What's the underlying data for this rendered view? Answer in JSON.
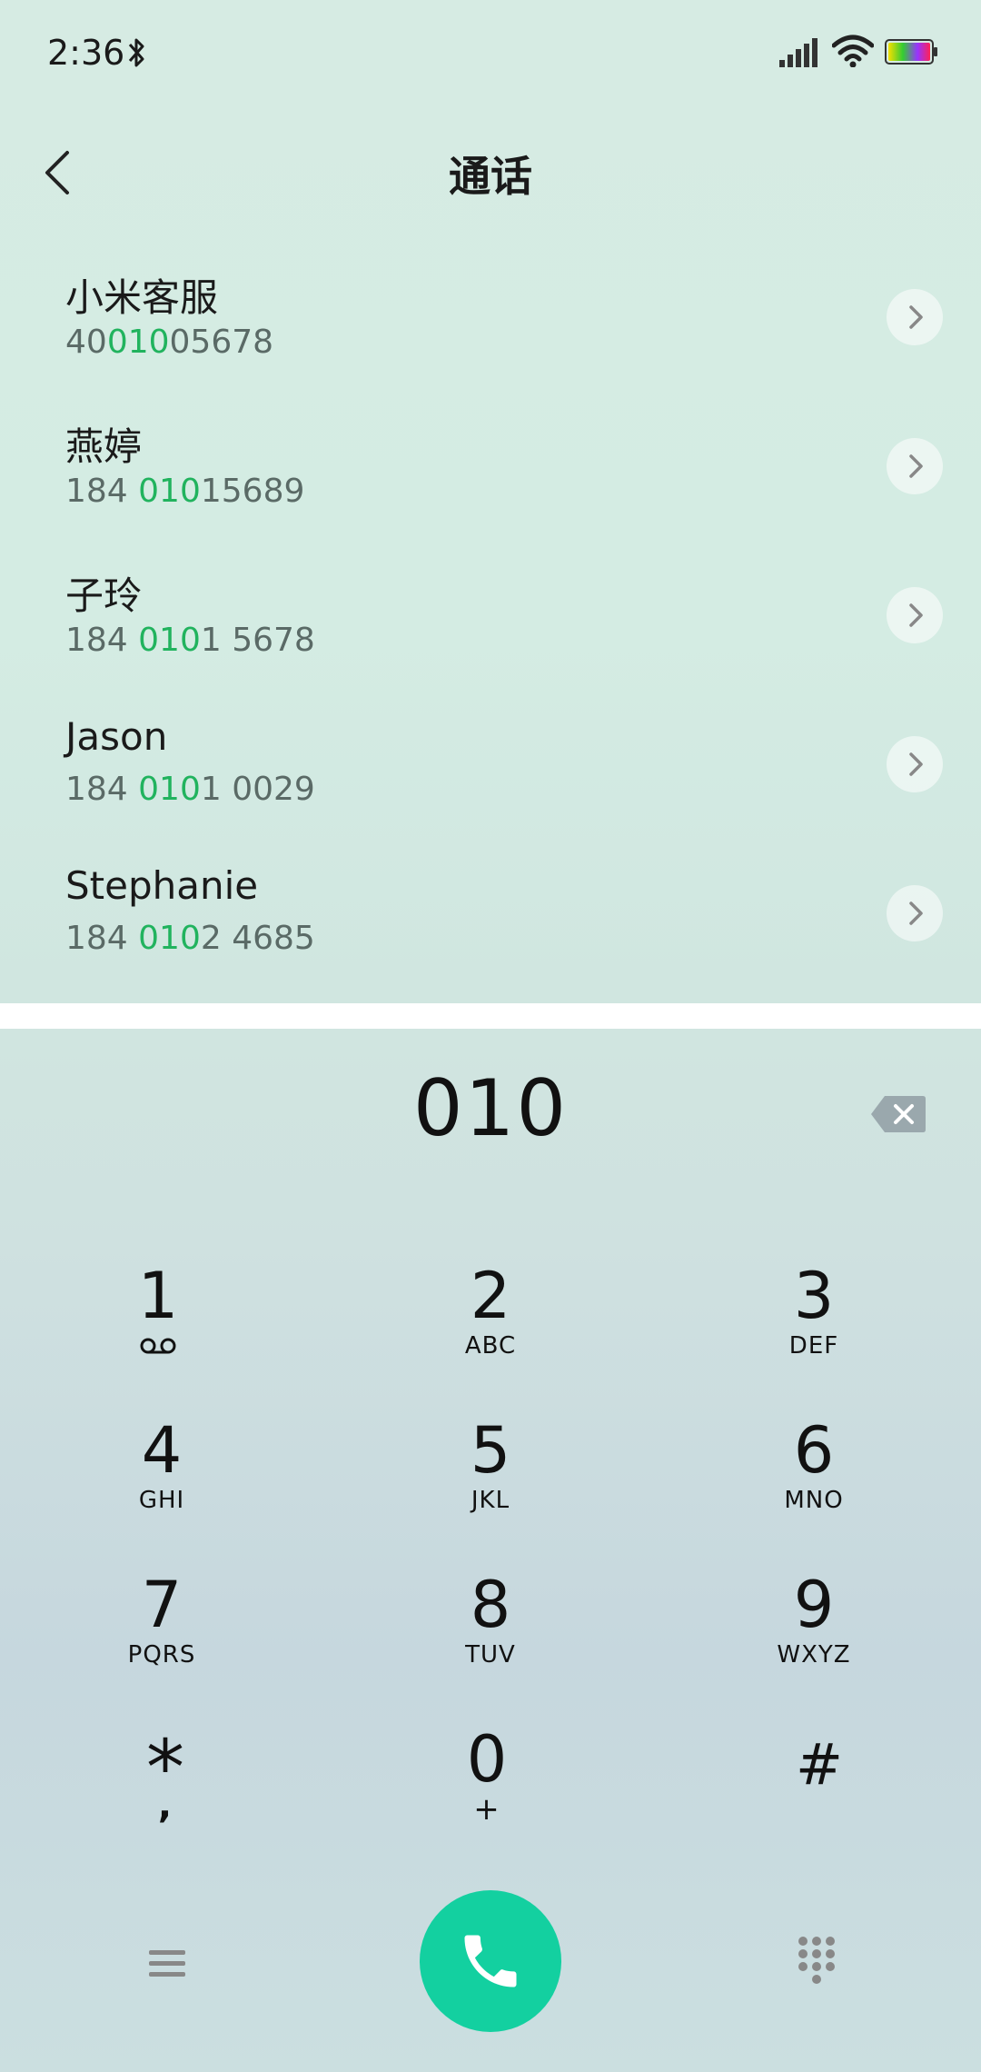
{
  "status_bar": {
    "time": "2:36",
    "icons": [
      "bluetooth-icon",
      "signal-icon",
      "wifi-icon",
      "battery-icon"
    ]
  },
  "header": {
    "title": "通话",
    "back_icon": "chevron-left-icon"
  },
  "contacts": [
    {
      "name": "小米客服",
      "number_pre": "40",
      "number_match": "010",
      "number_post": "05678"
    },
    {
      "name": "燕婷",
      "number_pre": "184 ",
      "number_match": "010",
      "number_post": "15689"
    },
    {
      "name": "子玲",
      "number_pre": "184 ",
      "number_match": "010",
      "number_post": "1 5678"
    },
    {
      "name": "Jason",
      "number_pre": "184 ",
      "number_match": "010",
      "number_post": "1 0029"
    },
    {
      "name": "Stephanie",
      "number_pre": "184 ",
      "number_match": "010",
      "number_post": "2 4685"
    }
  ],
  "dialer": {
    "input_value": "010",
    "delete_icon": "backspace-icon"
  },
  "keypad": {
    "keys": [
      {
        "digit": "1",
        "letters": ""
      },
      {
        "digit": "2",
        "letters": "ABC"
      },
      {
        "digit": "3",
        "letters": "DEF"
      },
      {
        "digit": "4",
        "letters": "GHI"
      },
      {
        "digit": "5",
        "letters": "JKL"
      },
      {
        "digit": "6",
        "letters": "MNO"
      },
      {
        "digit": "7",
        "letters": "PQRS"
      },
      {
        "digit": "8",
        "letters": "TUV"
      },
      {
        "digit": "9",
        "letters": "WXYZ"
      },
      {
        "digit": "*",
        "letters": ","
      },
      {
        "digit": "0",
        "letters": "+"
      },
      {
        "digit": "#",
        "letters": ""
      }
    ]
  },
  "bottom_bar": {
    "icons": [
      "menu-icon",
      "phone-icon",
      "dialpad-icon"
    ]
  },
  "colors": {
    "match_highlight": "#21b35e",
    "call_button": "#13d0a0",
    "divider": "#ffffff"
  }
}
